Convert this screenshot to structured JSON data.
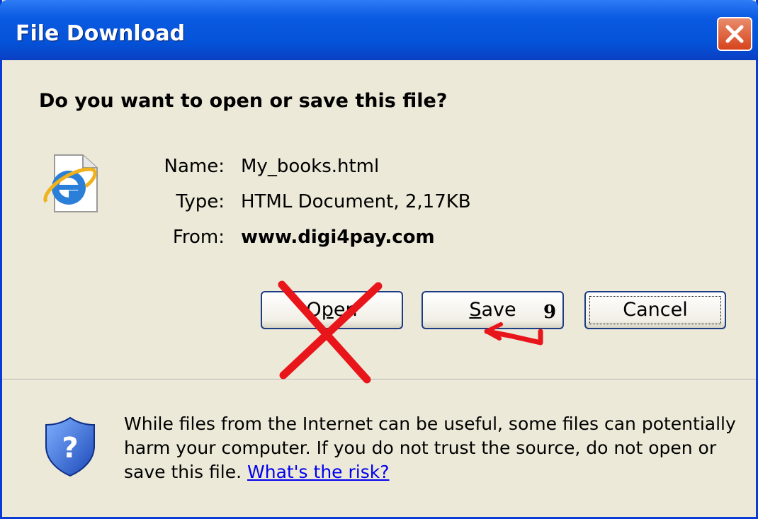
{
  "window": {
    "title": "File Download",
    "close_icon": "close-icon"
  },
  "question": "Do you want to open or save this file?",
  "file": {
    "icon": "ie-document-icon",
    "name_label": "Name:",
    "name_value": "My_books.html",
    "type_label": "Type:",
    "type_value": "HTML Document, 2,17KB",
    "from_label": "From:",
    "from_value": "www.digi4pay.com"
  },
  "buttons": {
    "open": {
      "pre": "O",
      "u": "p",
      "post": "en"
    },
    "save": {
      "pre": "",
      "u": "S",
      "post": "ave"
    },
    "cancel": "Cancel"
  },
  "warning": {
    "icon": "shield-question-icon",
    "text": "While files from the Internet can be useful, some files can potentially harm your computer. If you do not trust the source, do not open or save this file. ",
    "link": "What's the risk?"
  },
  "annotations": {
    "step_number": "9",
    "cross_color": "#e8151b",
    "arrow_color": "#e8151b"
  },
  "colors": {
    "titlebar": "#0453d8",
    "dialog_bg": "#ece9d8",
    "close_button": "#d6441c"
  }
}
